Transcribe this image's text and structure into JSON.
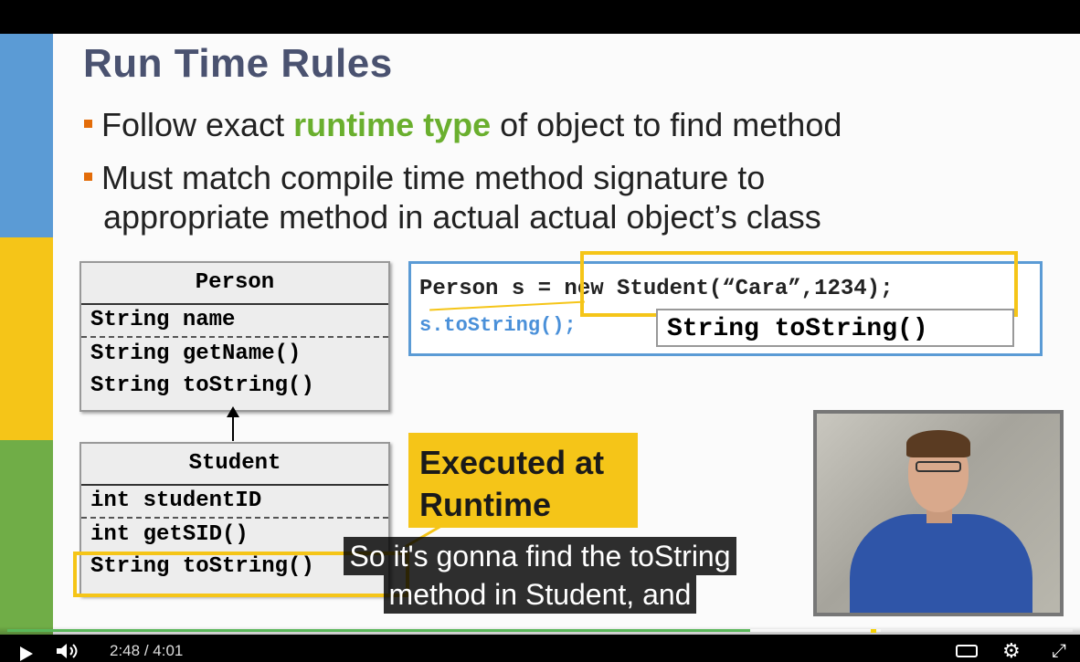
{
  "slide": {
    "title": "Run Time Rules",
    "bullets": {
      "b1_pre": "Follow exact ",
      "b1_hl": "runtime type",
      "b1_post": " of object to find method",
      "b2_line1": "Must match compile time method signature to",
      "b2_line2": "appropriate method in actual actual object’s class"
    },
    "person_class": {
      "name": "Person",
      "field": "String name",
      "methods": [
        "String getName()",
        "String toString()"
      ]
    },
    "student_class": {
      "name": "Student",
      "field": "int studentID",
      "methods": [
        "int getSID()",
        "String toString()"
      ]
    },
    "code": {
      "line1": "Person s = new Student(“Cara”,1234);",
      "line2": "s.toString();",
      "popup": "String toString()"
    },
    "executed_label_line1": "Executed at",
    "executed_label_line2": "Runtime"
  },
  "captions": {
    "line1": "So it's gonna find the toString",
    "line2": "method in Student, and"
  },
  "player": {
    "current_time": "2:48",
    "separator": "/",
    "duration": "4:01",
    "progress_fraction": 0.697,
    "buffer_fraction": 0.82,
    "accent_color": "#5ab75a",
    "icons": [
      "play-icon",
      "volume-icon",
      "captions-icon",
      "gear-icon",
      "fullscreen-icon"
    ]
  }
}
